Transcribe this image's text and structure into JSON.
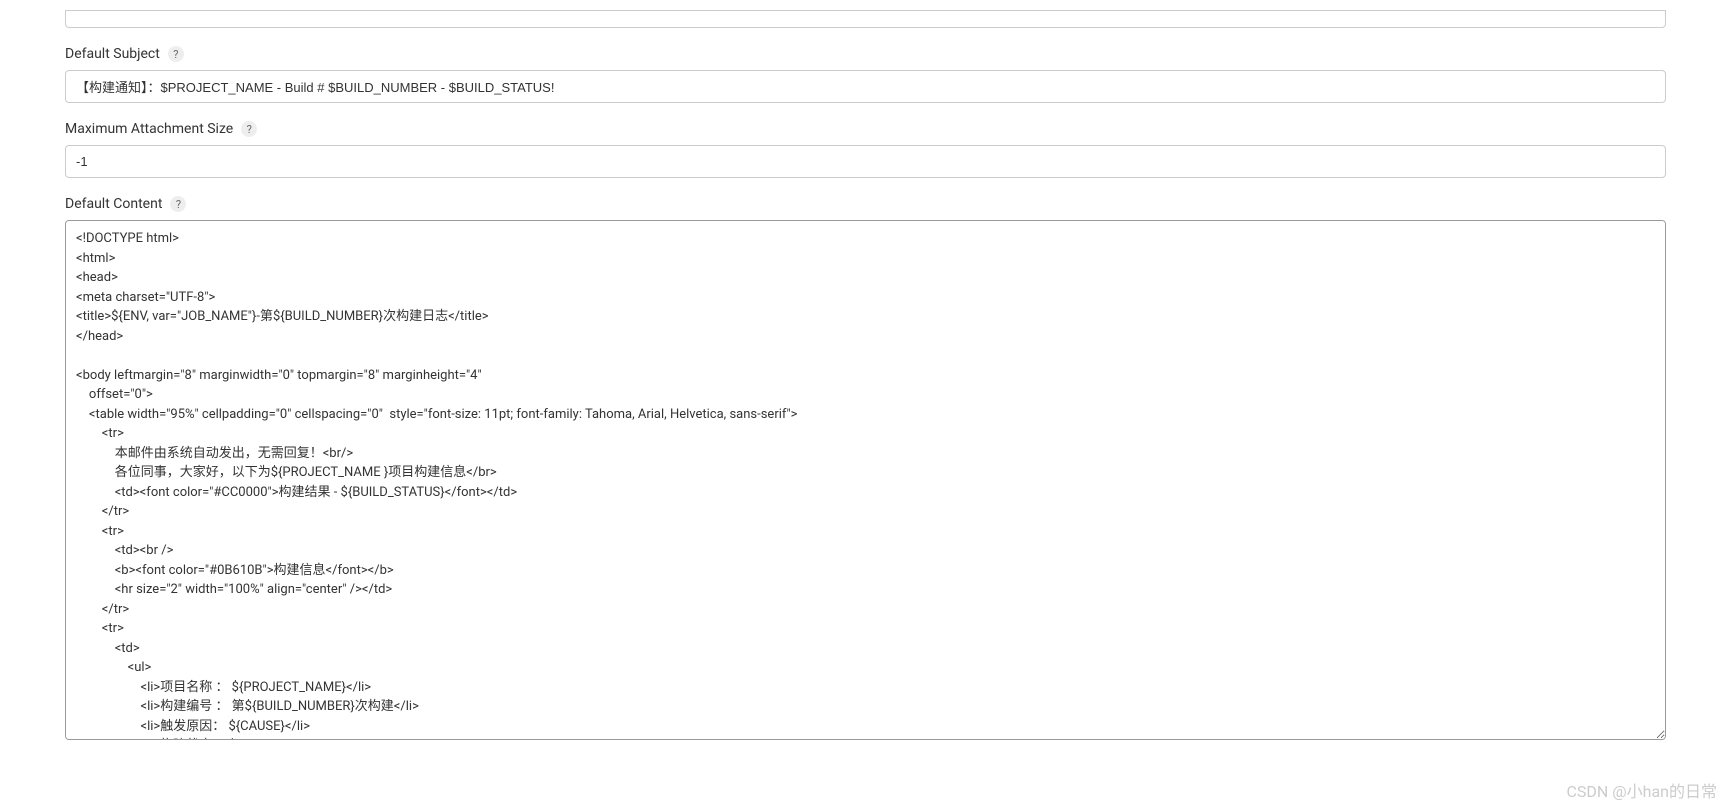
{
  "fields": {
    "defaultSubject": {
      "label": "Default Subject",
      "value": "【构建通知】：$PROJECT_NAME - Build # $BUILD_NUMBER - $BUILD_STATUS!"
    },
    "maxAttachmentSize": {
      "label": "Maximum Attachment Size",
      "value": "-1"
    },
    "defaultContent": {
      "label": "Default Content",
      "value": "<!DOCTYPE html>    \n<html>    \n<head>    \n<meta charset=\"UTF-8\">    \n<title>${ENV, var=\"JOB_NAME\"}-第${BUILD_NUMBER}次构建日志</title>    \n</head>    \n    \n<body leftmargin=\"8\" marginwidth=\"0\" topmargin=\"8\" marginheight=\"4\"    \n    offset=\"0\">    \n    <table width=\"95%\" cellpadding=\"0\" cellspacing=\"0\"  style=\"font-size: 11pt; font-family: Tahoma, Arial, Helvetica, sans-serif\">    \n        <tr>    \n            本邮件由系统自动发出，无需回复！<br/>            \n            各位同事，大家好，以下为${PROJECT_NAME }项目构建信息</br> \n            <td><font color=\"#CC0000\">构建结果 - ${BUILD_STATUS}</font></td>   \n        </tr>    \n        <tr>    \n            <td><br />    \n            <b><font color=\"#0B610B\">构建信息</font></b>    \n            <hr size=\"2\" width=\"100%\" align=\"center\" /></td>    \n        </tr>    \n        <tr>    \n            <td>    \n                <ul>    \n                    <li>项目名称 ： ${PROJECT_NAME}</li>    \n                    <li>构建编号 ： 第${BUILD_NUMBER}次构建</li>    \n                    <li>触发原因： ${CAUSE}</li>    \n                    <li>构建状态： ${BUILD_STATUS}</li>    \n                    <li>构建日志： <a href=\"${BUILD_URL}console\">${BUILD_URL}console</a></li>    \n                    <li>构建  Url ： <a href=\"${BUILD_URL}\">${BUILD_URL}</a></li>    \n                    <li>工作目录 ： <a href=\"${PROJECT_URL}ws\">${PROJECT_URL}ws</a></li>    \n                    <li>项目  Url ： <a href=\"${PROJECT_URL}\">${PROJECT_URL}</a></li>    \n                </ul>    \n\n<h4><font color=\"#0B610B\">失败用例</font></h4>\n<hr size=\"2\" width=\"100%\" />\n$FAILED_TESTS<br/>"
    }
  },
  "helpTooltip": "?",
  "watermark": "CSDN @小han的日常"
}
